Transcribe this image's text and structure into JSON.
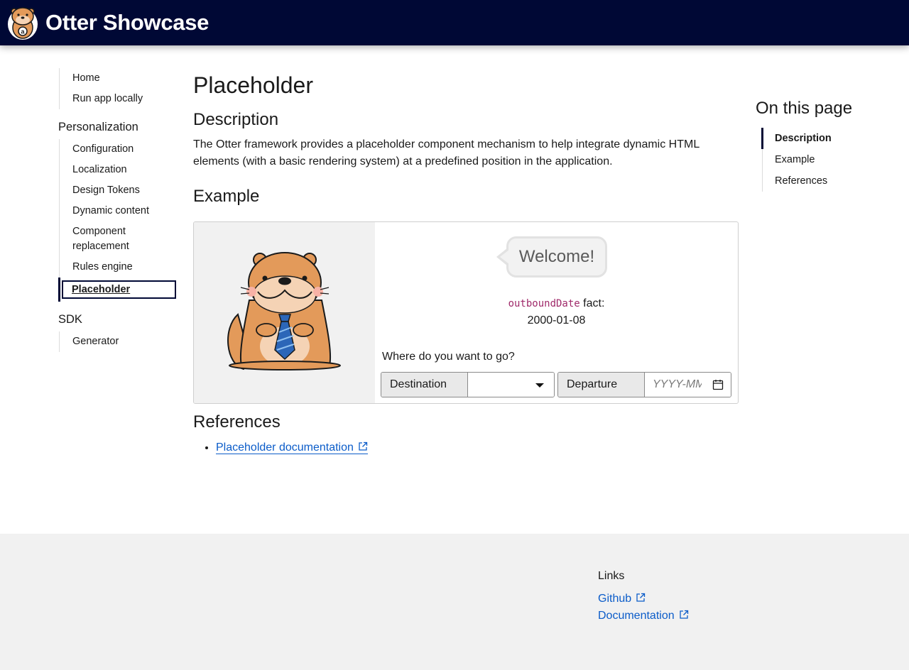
{
  "header": {
    "brand": "Otter Showcase",
    "logo_icon": "otter-logo-icon"
  },
  "sidebar": {
    "top_items": [
      {
        "label": "Home"
      },
      {
        "label": "Run app locally"
      }
    ],
    "groups": [
      {
        "heading": "Personalization",
        "items": [
          {
            "label": "Configuration"
          },
          {
            "label": "Localization"
          },
          {
            "label": "Design Tokens"
          },
          {
            "label": "Dynamic content"
          },
          {
            "label": "Component replacement"
          },
          {
            "label": "Rules engine"
          },
          {
            "label": "Placeholder",
            "active": true
          }
        ]
      },
      {
        "heading": "SDK",
        "items": [
          {
            "label": "Generator"
          }
        ]
      }
    ]
  },
  "main": {
    "title": "Placeholder",
    "description_heading": "Description",
    "description_text": "The Otter framework provides a placeholder component mechanism to help integrate dynamic HTML elements (with a basic rendering system) at a predefined position in the application.",
    "example_heading": "Example",
    "example": {
      "welcome": "Welcome!",
      "fact_code": "outboundDate",
      "fact_suffix": " fact:",
      "fact_value": "2000-01-08",
      "question": "Where do you want to go?",
      "destination_label": "Destination",
      "destination_value": "",
      "departure_label": "Departure",
      "departure_placeholder": "YYYY-MM-DD"
    },
    "references_heading": "References",
    "references": [
      {
        "label": "Placeholder documentation"
      }
    ]
  },
  "toc": {
    "title": "On this page",
    "items": [
      {
        "label": "Description",
        "active": true
      },
      {
        "label": "Example"
      },
      {
        "label": "References"
      }
    ]
  },
  "footer": {
    "links_title": "Links",
    "links": [
      {
        "label": "Github"
      },
      {
        "label": "Documentation"
      }
    ]
  },
  "colors": {
    "header_bg": "#000835",
    "link": "#0b5cc9",
    "code": "#a02a6a",
    "footer_bg": "#f1f1f1"
  }
}
